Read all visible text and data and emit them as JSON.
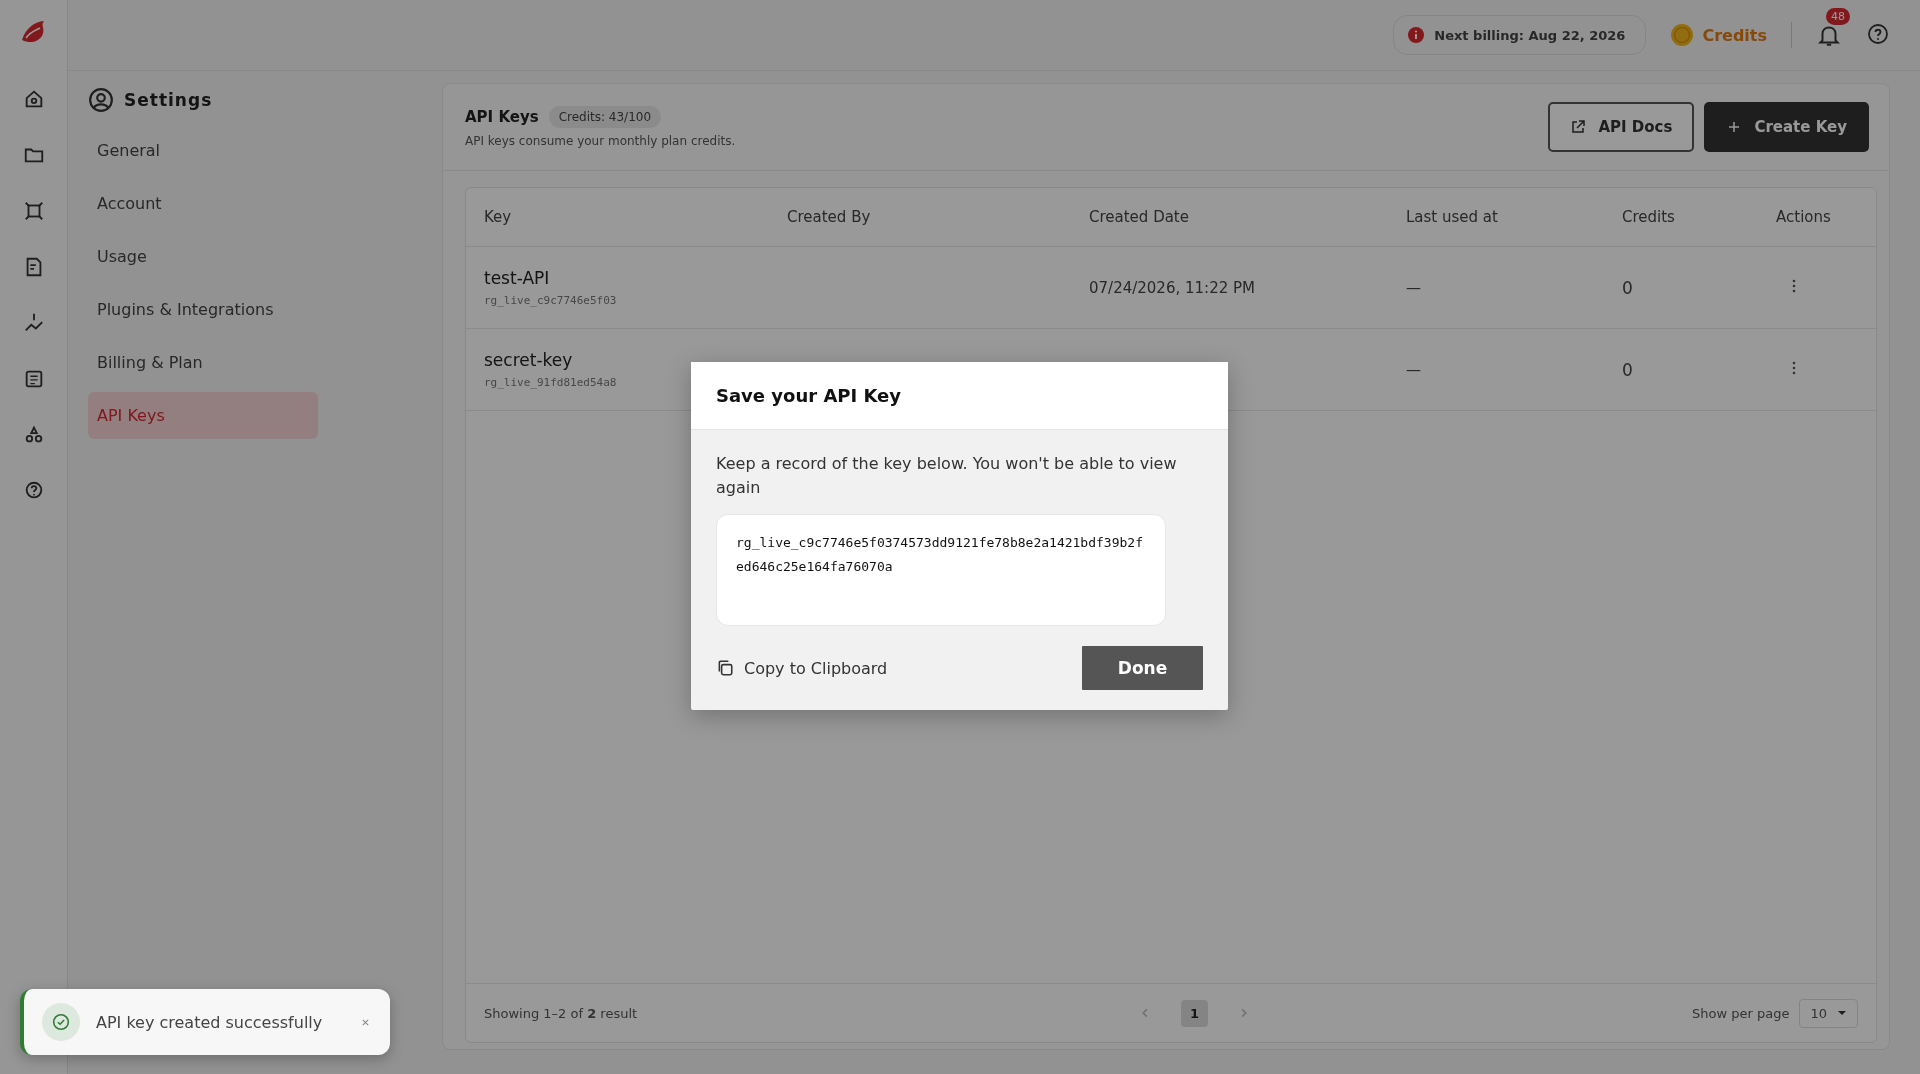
{
  "top_bar": {
    "billing": "Next billing: Aug 22, 2026",
    "credits": "Credits",
    "notifications_count": "48"
  },
  "settings": {
    "title": "Settings",
    "items": [
      {
        "label": "General",
        "selected": false
      },
      {
        "label": "Account",
        "selected": false
      },
      {
        "label": "Usage",
        "selected": false
      },
      {
        "label": "Plugins & Integrations",
        "selected": false
      },
      {
        "label": "Billing & Plan",
        "selected": false
      },
      {
        "label": "API Keys",
        "selected": true
      }
    ]
  },
  "page": {
    "title": "API Keys",
    "credits_badge": "Credits: 43/100",
    "subtitle": "API keys consume your monthly plan credits.",
    "buttons": [
      {
        "label": "API Docs",
        "kind": "secondary"
      },
      {
        "label": "Create Key",
        "kind": "primary"
      }
    ]
  },
  "table": {
    "columns": [
      "Key",
      "Created By",
      "Created Date",
      "Last used at",
      "Credits",
      "Actions"
    ],
    "rows": [
      {
        "name": "test-API",
        "prefix": "rg_live_c9c7746e5f03",
        "created_date": "07/24/2026, 11:22 PM",
        "last_used": "—",
        "credits": "0"
      },
      {
        "name": "secret-key",
        "prefix": "rg_live_91fd81ed54a8",
        "last_used": "—",
        "credits": "0"
      }
    ]
  },
  "footer": {
    "showing": "Showing 1–2 of **2** result",
    "pages": [
      {
        "label": "1",
        "selected": true
      }
    ],
    "per_page_label": "Show per page",
    "per_page": "10"
  },
  "dialog": {
    "title": "Save your API Key",
    "message": "Keep a record of the key below. You won't be able to view again",
    "key": "rg_live_c9c7746e5f0374573dd9121fe78b8e2a1421bdf39b2fed646c25e164fa76070a",
    "copy": "Copy to Clipboard",
    "done": "Done"
  },
  "toast": {
    "message": "API key created successfully"
  }
}
